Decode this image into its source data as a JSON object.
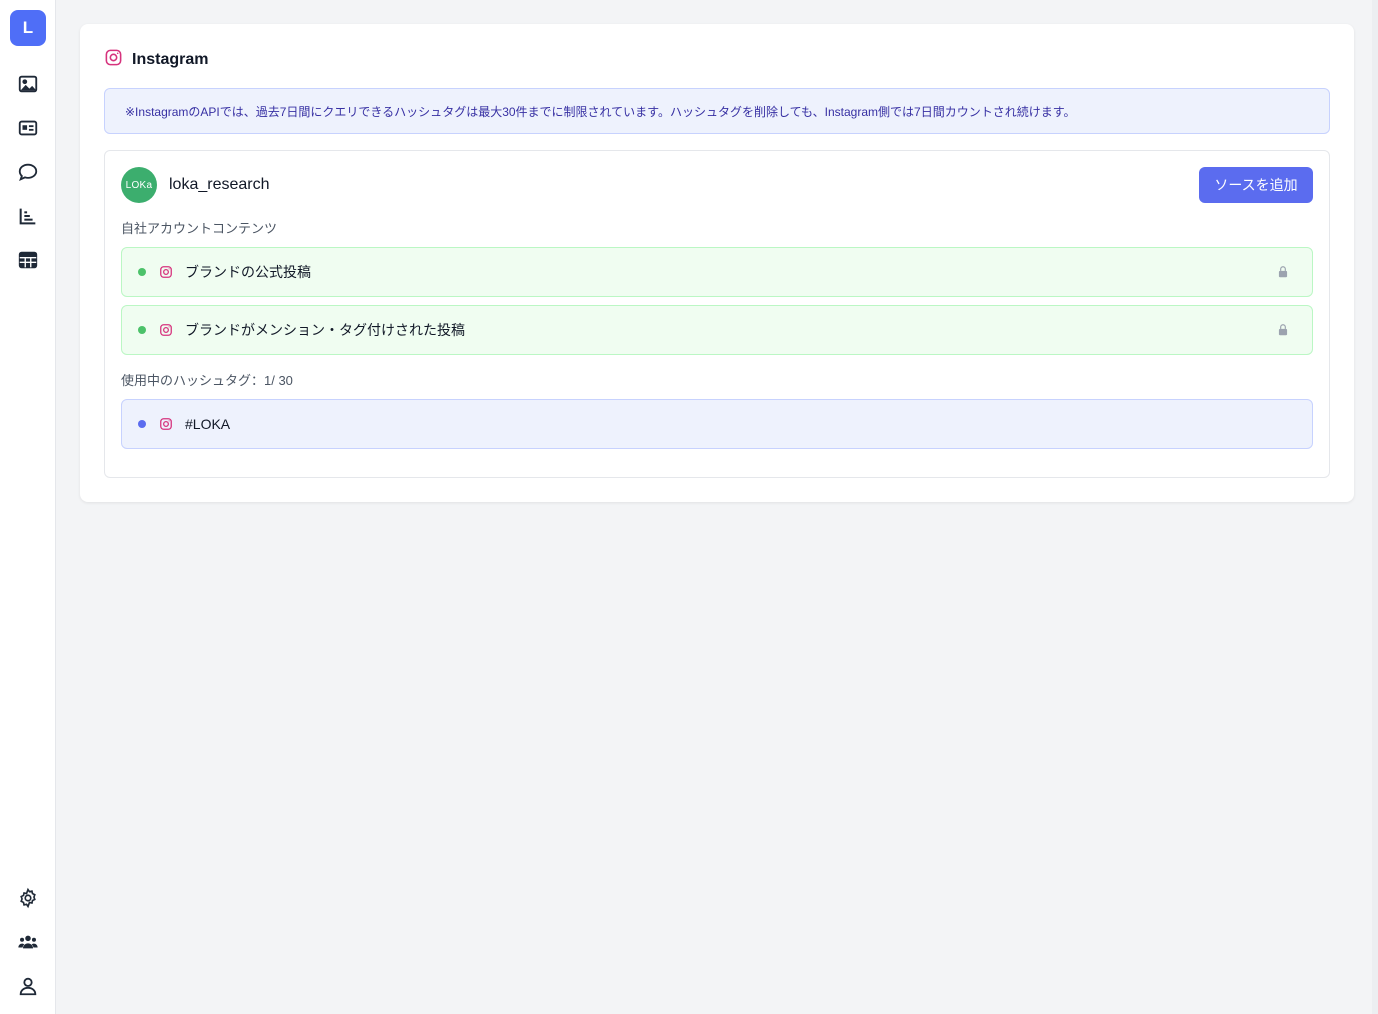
{
  "sidebar": {
    "logo_letter": "L",
    "brand_color": "#4f6ef7",
    "top_items": [
      {
        "icon": "image-icon"
      },
      {
        "icon": "id-card-icon"
      },
      {
        "icon": "chat-bubble-icon"
      },
      {
        "icon": "bar-chart-icon"
      },
      {
        "icon": "table-grid-icon"
      }
    ],
    "bottom_items": [
      {
        "icon": "gear-icon"
      },
      {
        "icon": "users-group-icon"
      },
      {
        "icon": "user-icon"
      }
    ]
  },
  "panel": {
    "title": "Instagram",
    "notice": "※InstagramのAPIでは、過去7日間にクエリできるハッシュタグは最大30件までに制限されています。ハッシュタグを削除しても、Instagram側では7日間カウントされ続けます。",
    "account": {
      "avatar_text": "LOKa",
      "name": "loka_research",
      "avatar_color": "#3cae6e"
    },
    "add_source_label": "ソースを追加",
    "own_content_label": "自社アカウントコンテンツ",
    "own_sources": [
      {
        "label": "ブランドの公式投稿",
        "locked": true
      },
      {
        "label": "ブランドがメンション・タグ付けされた投稿",
        "locked": true
      }
    ],
    "hashtag_label": "使用中のハッシュタグ：1/ 30",
    "hashtags": [
      {
        "label": "#LOKA"
      }
    ]
  },
  "colors": {
    "accent": "#5b6cef",
    "instagram": "#d6337d",
    "active_green": "#4cc26a"
  }
}
